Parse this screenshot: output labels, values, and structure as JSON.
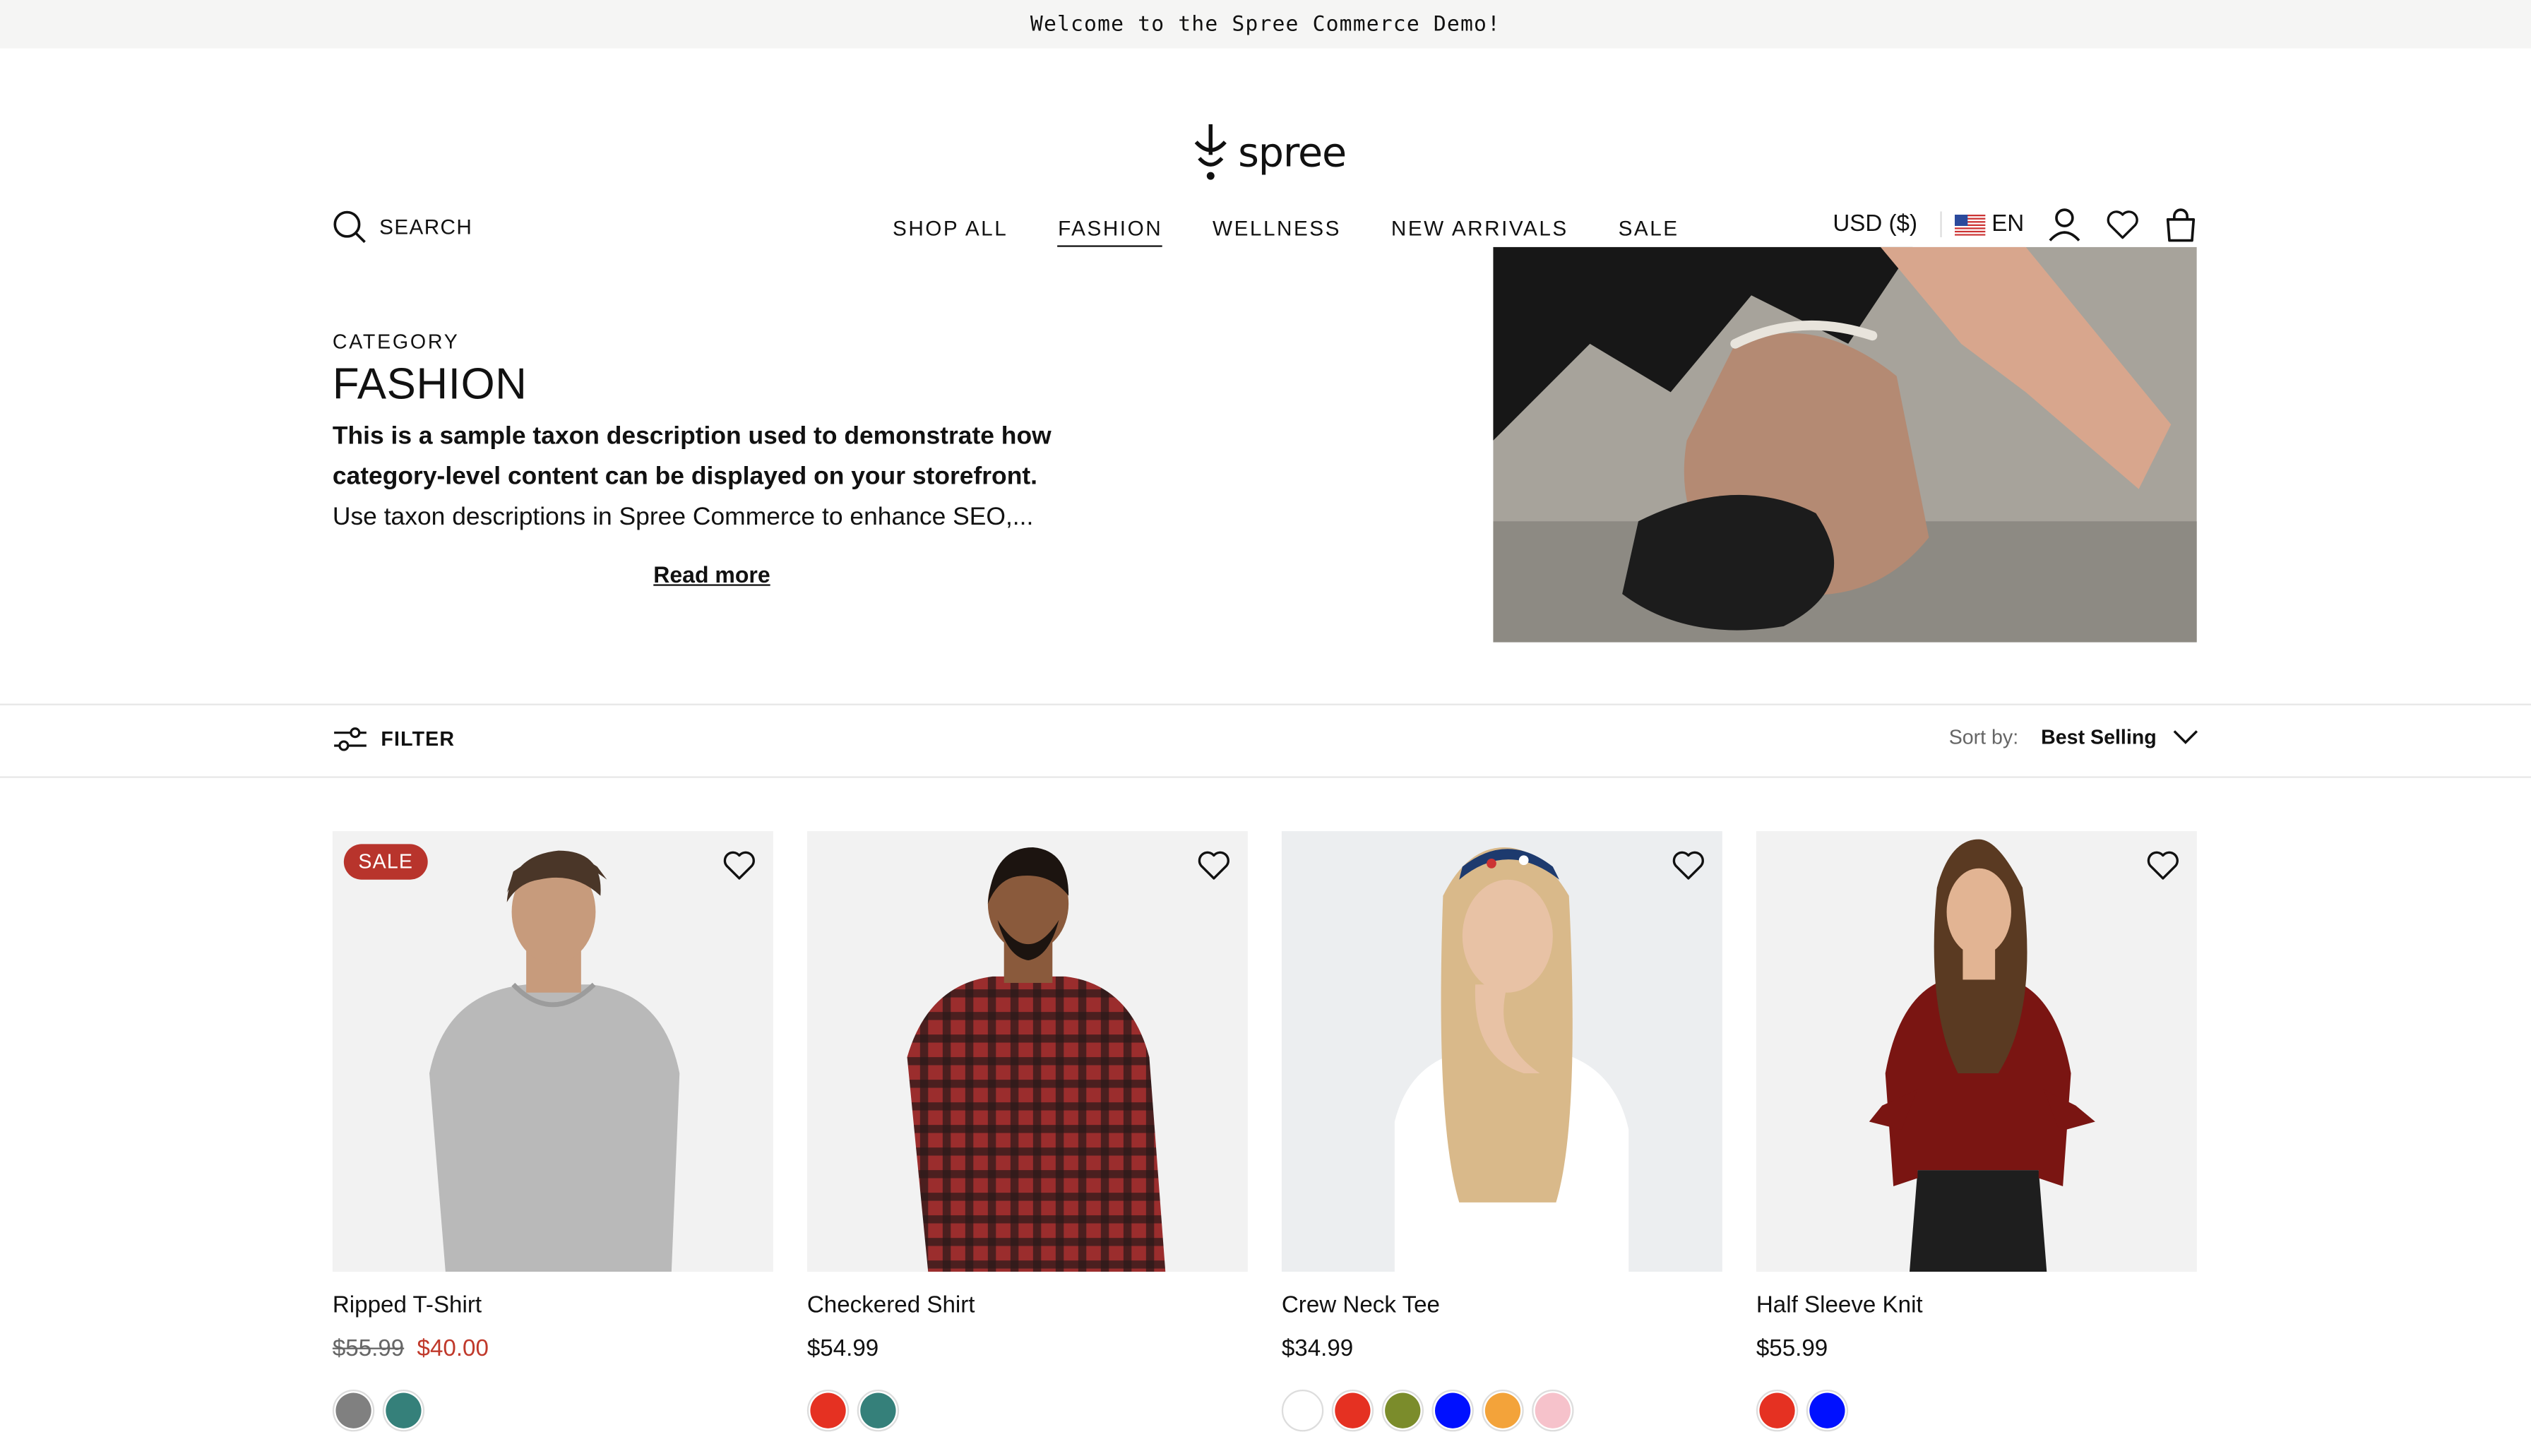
{
  "banner": {
    "text": "Welcome to the Spree Commerce Demo!"
  },
  "header": {
    "logo_text": "spree",
    "search_label": "SEARCH",
    "nav": [
      {
        "label": "SHOP ALL"
      },
      {
        "label": "FASHION"
      },
      {
        "label": "WELLNESS"
      },
      {
        "label": "NEW ARRIVALS"
      },
      {
        "label": "SALE"
      }
    ],
    "currency": "USD ($)",
    "language": "EN"
  },
  "hero": {
    "category_label": "CATEGORY",
    "title": "FASHION",
    "description_bold": "This is a sample taxon description used to demonstrate how category-level content can be displayed on your storefront.",
    "description": "Use taxon descriptions in Spree Commerce to enhance SEO,...",
    "read_more": "Read more"
  },
  "toolbar": {
    "filter_label": "FILTER",
    "sort_label": "Sort by:",
    "sort_value": "Best Selling"
  },
  "products": [
    {
      "name": "Ripped T-Shirt",
      "old_price": "$55.99",
      "price": "$40.00",
      "badge": "SALE",
      "swatches": [
        "#808080",
        "#35807a"
      ]
    },
    {
      "name": "Checkered Shirt",
      "price": "$54.99",
      "swatches": [
        "#e53122",
        "#35807a"
      ]
    },
    {
      "name": "Crew Neck Tee",
      "price": "$34.99",
      "swatches": [
        "#ffffff",
        "#e53122",
        "#7b8c2b",
        "#0010ff",
        "#f3a33a",
        "#f6c2cb"
      ]
    },
    {
      "name": "Half Sleeve Knit",
      "price": "$55.99",
      "swatches": [
        "#e53122",
        "#0010ff"
      ]
    }
  ],
  "colors": {
    "sale_red": "#c0392b",
    "badge_bg": "#b8342c",
    "banner_bg": "#f5f5f4"
  }
}
